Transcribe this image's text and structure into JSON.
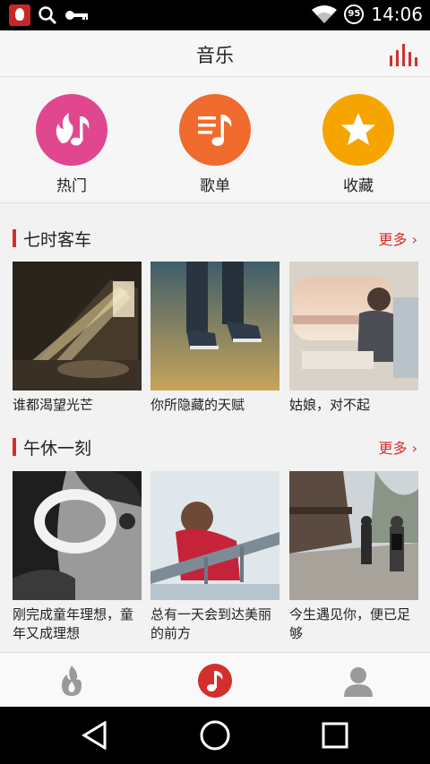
{
  "status_bar": {
    "time": "14:06",
    "battery_level": "95",
    "icons": [
      "app-notification-icon",
      "search-icon",
      "key-icon",
      "wifi-icon",
      "battery-icon"
    ]
  },
  "header": {
    "title": "音乐",
    "right_icon": "equalizer-icon",
    "accent_color": "#d32f2f"
  },
  "shortcuts": [
    {
      "label": "热门",
      "icon": "fire-music-icon",
      "color": "#e0478f"
    },
    {
      "label": "歌单",
      "icon": "playlist-note-icon",
      "color": "#ef6b2e"
    },
    {
      "label": "收藏",
      "icon": "star-icon",
      "color": "#f6a500"
    }
  ],
  "sections": [
    {
      "title": "七时客车",
      "more_label": "更多",
      "items": [
        {
          "caption": "谁都渴望光芒",
          "image": "light-in-cave-photo"
        },
        {
          "caption": "你所隐藏的天赋",
          "image": "sneakers-on-road-photo"
        },
        {
          "caption": "姑娘，对不起",
          "image": "man-by-train-window-photo"
        }
      ]
    },
    {
      "title": "午休一刻",
      "more_label": "更多",
      "items": [
        {
          "caption": "刚完成童年理想，童年又成理想",
          "image": "boy-with-glasses-photo"
        },
        {
          "caption": "总有一天会到达美丽的前方",
          "image": "woman-on-railing-photo"
        },
        {
          "caption": "今生遇见你，便已足够",
          "image": "street-people-walking-photo"
        }
      ]
    }
  ],
  "tabbar": {
    "tabs": [
      "flame-tab-icon",
      "music-tab-icon",
      "user-tab-icon"
    ],
    "active_index": 1
  },
  "navbar": {
    "buttons": [
      "back-icon",
      "home-icon",
      "recents-icon"
    ]
  }
}
